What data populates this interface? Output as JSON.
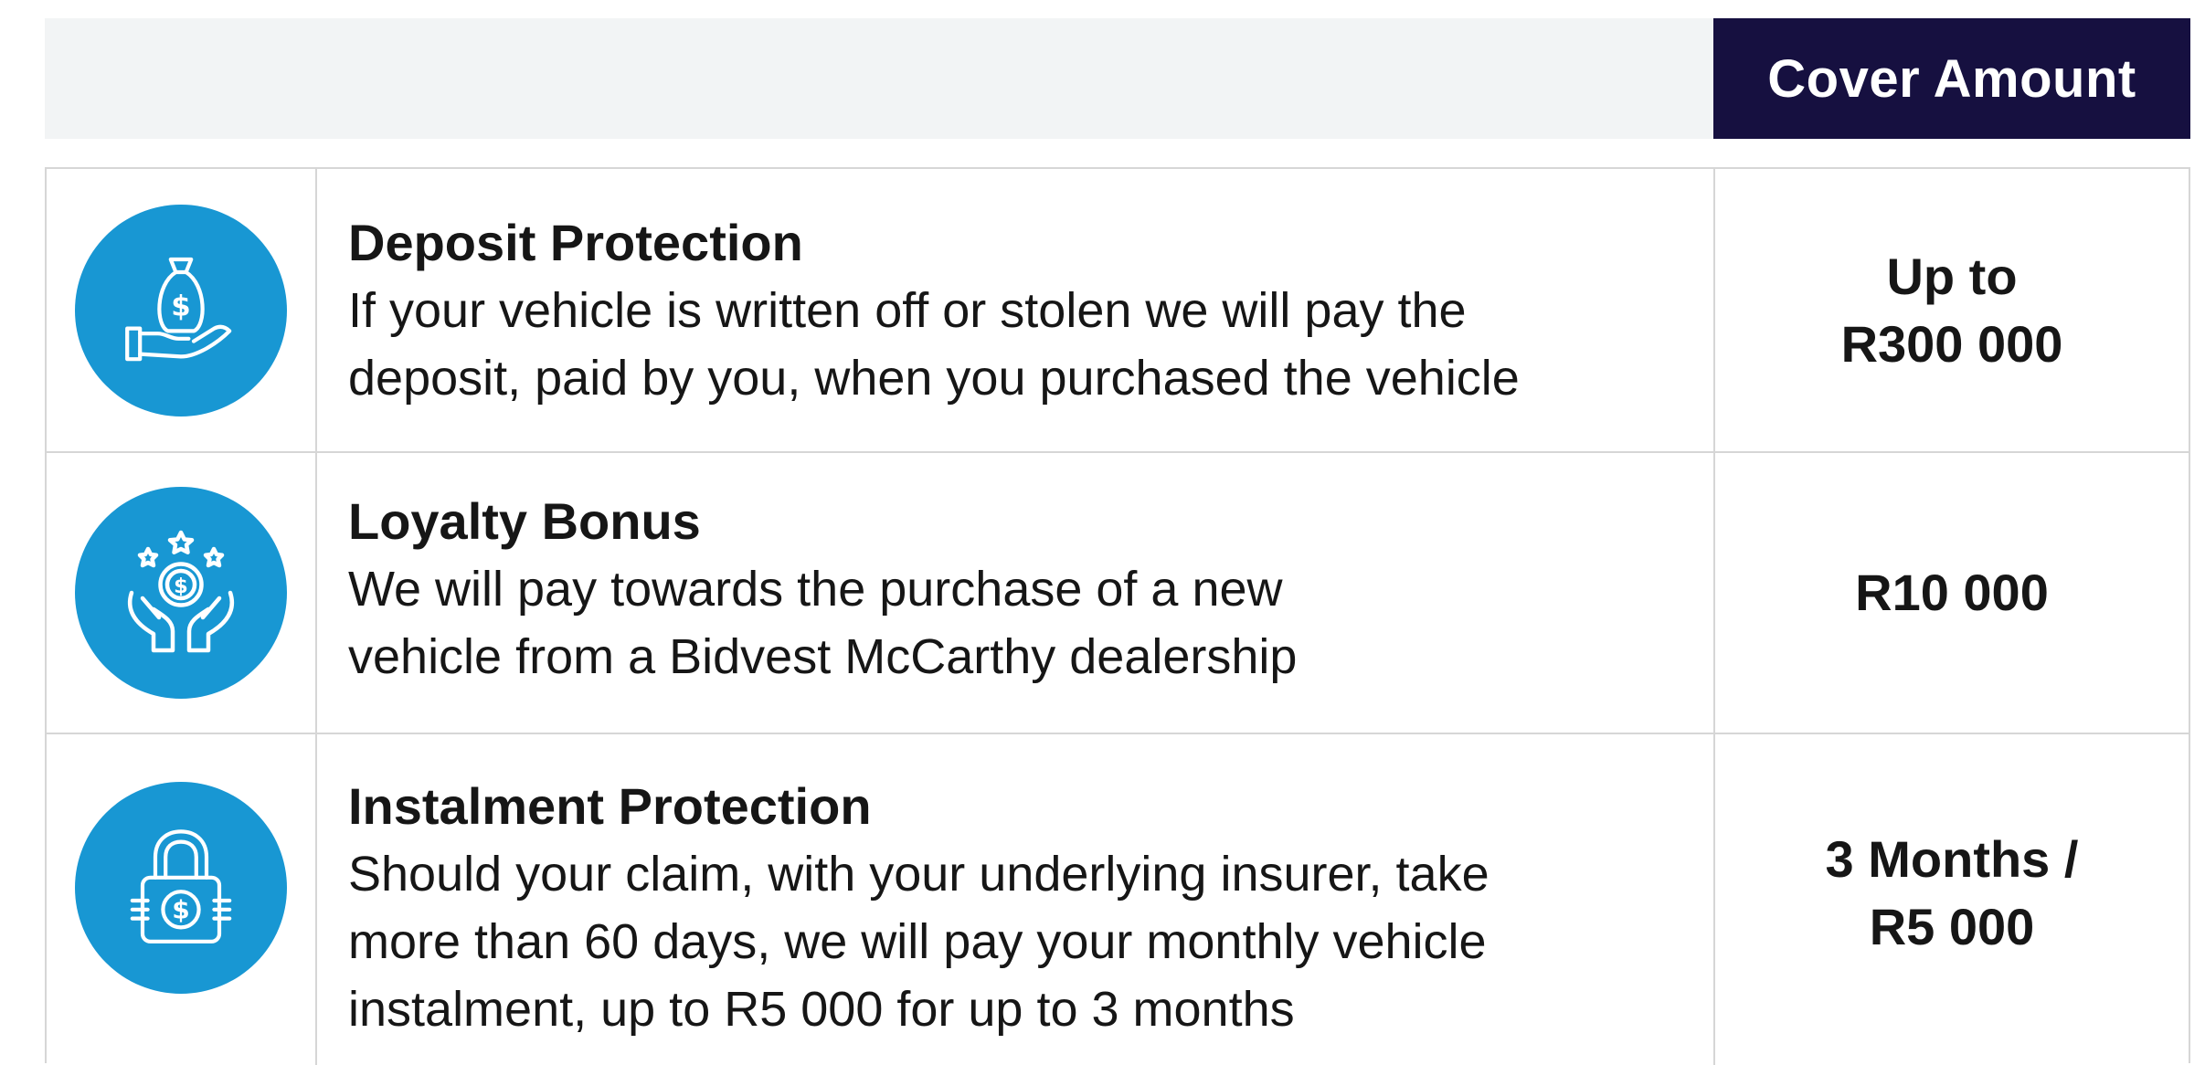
{
  "header": {
    "cover_amount_label": "Cover Amount"
  },
  "colors": {
    "header_band": "#f2f4f5",
    "header_cell": "#161040",
    "icon_circle": "#1897d3",
    "border": "#d6d6d6"
  },
  "rows": [
    {
      "icon": "money-bag-hand-icon",
      "title": "Deposit Protection",
      "desc_lines": [
        "If your vehicle is written off or stolen we will pay the",
        "deposit, paid by you, when you purchased the vehicle"
      ],
      "amount_lines": [
        "Up to",
        "R300 000"
      ]
    },
    {
      "icon": "coin-hands-stars-icon",
      "title": "Loyalty Bonus",
      "desc_lines": [
        "We will pay towards the purchase of a new",
        "vehicle from a Bidvest McCarthy dealership"
      ],
      "amount_lines": [
        "R10 000"
      ]
    },
    {
      "icon": "dollar-padlock-icon",
      "title": "Instalment Protection",
      "desc_lines": [
        "Should your claim, with your underlying insurer, take",
        "more than 60 days, we will pay your monthly vehicle",
        "instalment, up to R5 000 for up to 3 months"
      ],
      "amount_lines": [
        "3 Months /",
        "R5 000"
      ]
    }
  ]
}
